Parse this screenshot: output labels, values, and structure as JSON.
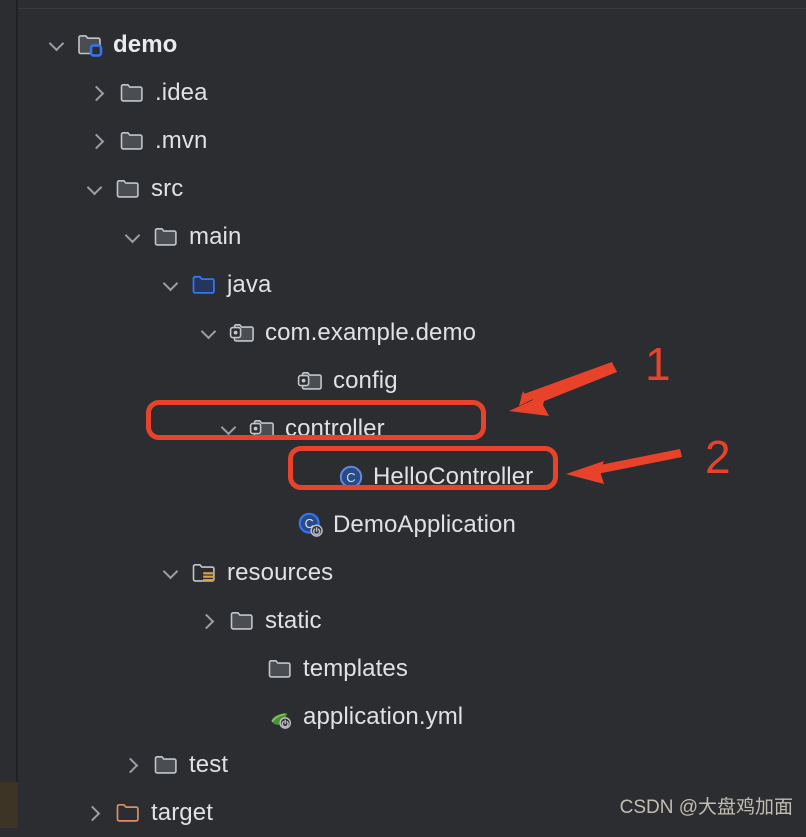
{
  "panel": {
    "name": "project-tree",
    "background": "#2b2d30",
    "selection_color": "#43454a",
    "excluded_color": "#3e3425",
    "text_color": "#dfe1e5",
    "accent_red": "#e8432a",
    "accent_blue": "#3574f0"
  },
  "tree": [
    {
      "label": "demo",
      "icon": "module-folder-icon",
      "toggle": "chevron-down",
      "depth": 0,
      "bold": true,
      "state": "expanded",
      "row": "tree-row-demo"
    },
    {
      "label": ".idea",
      "icon": "folder-icon",
      "toggle": "chevron-right",
      "depth": 1,
      "bold": false,
      "state": "collapsed",
      "row": "tree-row-idea"
    },
    {
      "label": ".mvn",
      "icon": "folder-icon",
      "toggle": "chevron-right",
      "depth": 1,
      "bold": false,
      "state": "collapsed",
      "row": "tree-row-mvn"
    },
    {
      "label": "src",
      "icon": "folder-icon",
      "toggle": "chevron-down",
      "depth": 1,
      "bold": false,
      "state": "expanded",
      "row": "tree-row-src"
    },
    {
      "label": "main",
      "icon": "folder-icon",
      "toggle": "chevron-down",
      "depth": 2,
      "bold": false,
      "state": "expanded",
      "row": "tree-row-main"
    },
    {
      "label": "java",
      "icon": "source-root-folder-icon",
      "toggle": "chevron-down",
      "depth": 3,
      "bold": false,
      "state": "expanded",
      "row": "tree-row-java"
    },
    {
      "label": "com.example.demo",
      "icon": "package-icon",
      "toggle": "chevron-down",
      "depth": 4,
      "bold": false,
      "state": "expanded",
      "row": "tree-row-com-example-demo"
    },
    {
      "label": "config",
      "icon": "package-icon",
      "toggle": "none",
      "depth": 5,
      "bold": false,
      "state": "leaf",
      "row": "tree-row-config"
    },
    {
      "label": "controller",
      "icon": "package-icon",
      "toggle": "chevron-down",
      "depth": 5,
      "bold": false,
      "state": "expanded",
      "row": "tree-row-controller"
    },
    {
      "label": "HelloController",
      "icon": "java-class-icon",
      "toggle": "none",
      "depth": 6,
      "bold": false,
      "state": "leaf",
      "row": "tree-row-hellocontroller"
    },
    {
      "label": "DemoApplication",
      "icon": "spring-boot-class-icon",
      "toggle": "none",
      "depth": 5,
      "bold": false,
      "state": "leaf",
      "row": "tree-row-demoapplication"
    },
    {
      "label": "resources",
      "icon": "resources-folder-icon",
      "toggle": "chevron-down",
      "depth": 3,
      "bold": false,
      "state": "selected",
      "row": "tree-row-resources"
    },
    {
      "label": "static",
      "icon": "folder-icon",
      "toggle": "chevron-right",
      "depth": 4,
      "bold": false,
      "state": "collapsed",
      "row": "tree-row-static"
    },
    {
      "label": "templates",
      "icon": "folder-icon",
      "toggle": "none",
      "depth": 4,
      "bold": false,
      "state": "leaf",
      "row": "tree-row-templates"
    },
    {
      "label": "application.yml",
      "icon": "spring-yaml-icon",
      "toggle": "none",
      "depth": 4,
      "bold": false,
      "state": "leaf",
      "row": "tree-row-application-yml"
    },
    {
      "label": "test",
      "icon": "folder-icon",
      "toggle": "chevron-right",
      "depth": 2,
      "bold": false,
      "state": "collapsed",
      "row": "tree-row-test"
    },
    {
      "label": "target",
      "icon": "excluded-folder-icon",
      "toggle": "chevron-right",
      "depth": 1,
      "bold": false,
      "state": "excluded",
      "row": "tree-row-target"
    }
  ],
  "annotations": {
    "marker_1": "1",
    "marker_2": "2",
    "highlight_1_target": "controller",
    "highlight_2_target": "HelloController"
  },
  "watermark": {
    "text": "CSDN @大盘鸡加面"
  }
}
